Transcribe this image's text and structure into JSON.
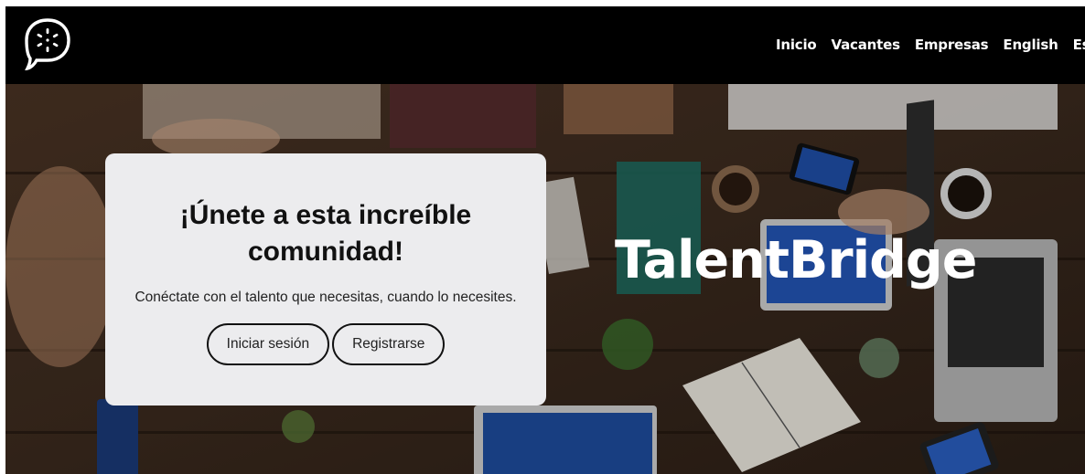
{
  "navbar": {
    "logo_icon": "speech-bubble-logo-icon",
    "links": [
      "Inicio",
      "Vacantes",
      "Empresas",
      "English",
      "Español"
    ]
  },
  "hero": {
    "brand": "TalentBridge",
    "card": {
      "title": "¡Únete a esta increíble comunidad!",
      "text": "Conéctate con el talento que necesitas, cuando lo necesites.",
      "login_label": "Iniciar sesión",
      "register_label": "Registrarse"
    }
  },
  "colors": {
    "navbar_bg": "#000000",
    "card_bg": "#ececee",
    "text_white": "#ffffff"
  }
}
